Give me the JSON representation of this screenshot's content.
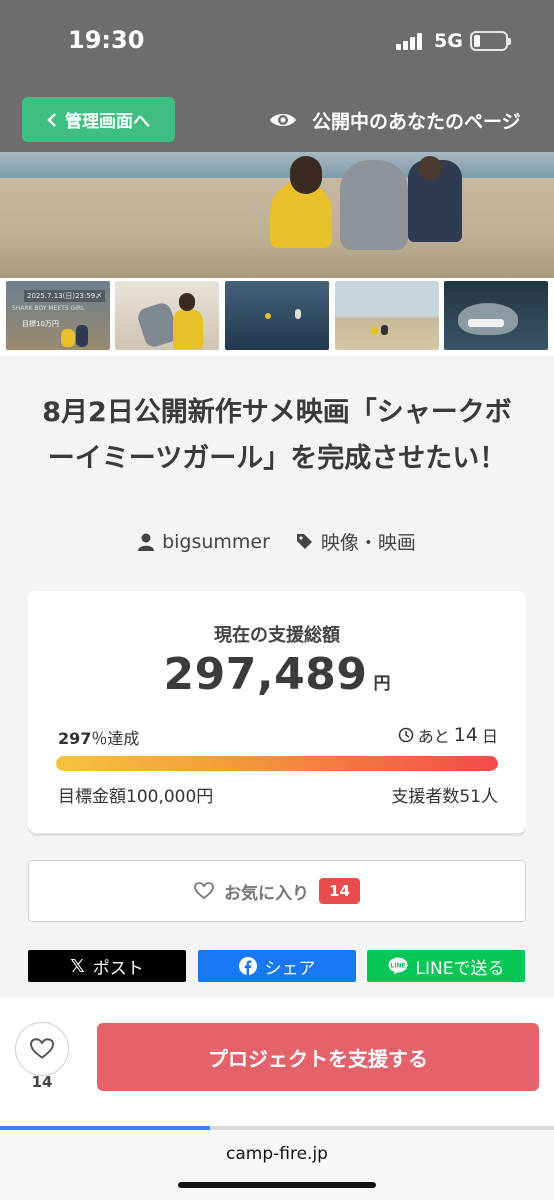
{
  "status_bar": {
    "time": "19:30",
    "network": "5G"
  },
  "header": {
    "admin_button": "管理画面へ",
    "public_page_link": "公開中のあなたのページ"
  },
  "thumbnails": [
    {
      "caption_top": "2025.7.13(日)23:59〆",
      "caption_mid": "SHARK BOY MEETS GIRL",
      "caption_bottom": "目標10万円"
    },
    {},
    {},
    {},
    {}
  ],
  "project": {
    "title": "8月2日公開新作サメ映画「シャークボーイミーツガール」を完成させたい！",
    "owner": "bigsummer",
    "category": "映像・映画"
  },
  "funding": {
    "label": "現在の支援総額",
    "amount": "297,489",
    "currency": "円",
    "percent_number": "297",
    "percent_suffix": "％達成",
    "days_prefix": "あと",
    "days_number": "14",
    "days_suffix": "日",
    "progress_fraction": 1.0,
    "goal": "目標金額100,000円",
    "backers": "支援者数51人"
  },
  "favorite": {
    "label": "お気に入り",
    "count": "14"
  },
  "share": {
    "x_label": "ポスト",
    "facebook_label": "シェア",
    "line_label": "LINEで送る",
    "x_color": "#000000",
    "facebook_color": "#1877f2",
    "line_color": "#06c755"
  },
  "bottom_bar": {
    "like_count": "14",
    "support_button": "プロジェクトを支援する"
  },
  "browser": {
    "url": "camp-fire.jp"
  }
}
